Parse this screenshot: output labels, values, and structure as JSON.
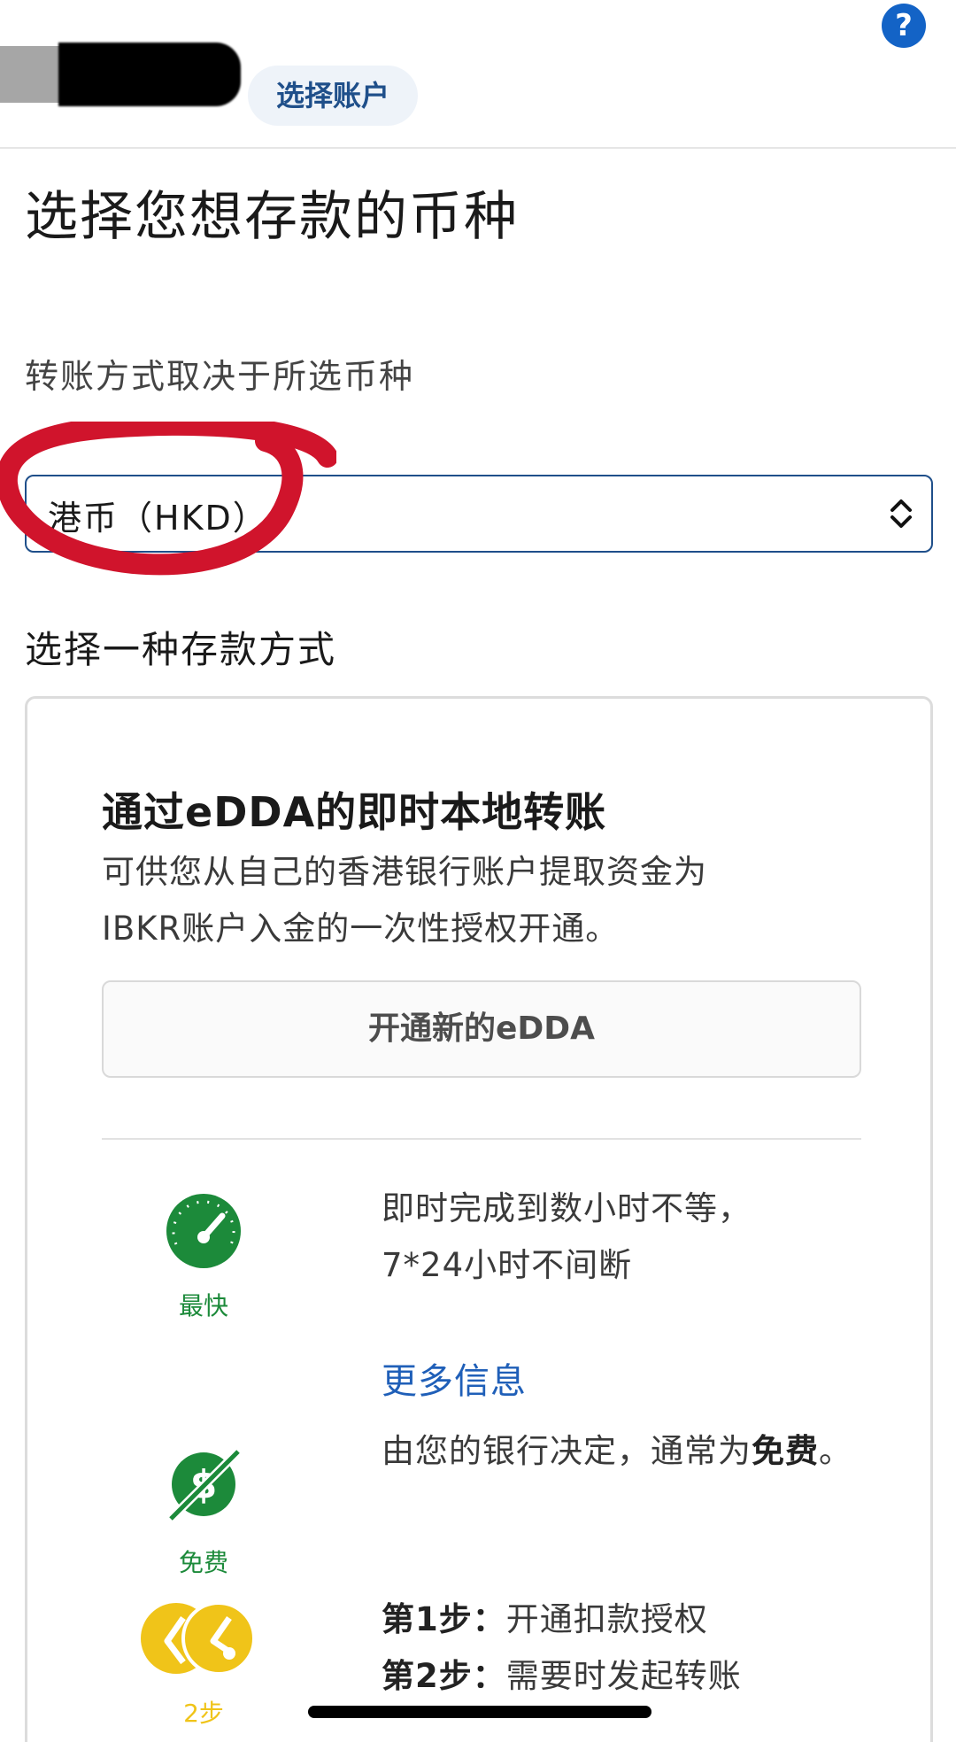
{
  "header": {
    "account_label": "选择账户",
    "help_label": "?"
  },
  "main": {
    "title": "选择您想存款的币种",
    "hint": "转账方式取决于所选币种",
    "currency_selected": "港币（HKD）",
    "methods_title": "选择一种存款方式"
  },
  "card": {
    "title": "通过eDDA的即时本地转账",
    "desc_line1": "可供您从自己的香港银行账户提取资金为",
    "desc_line2": "IBKR账户入金的一次性授权开通。",
    "button": "开通新的eDDA",
    "speed": {
      "icon": "speedometer-icon",
      "caption": "最快",
      "line1": "即时完成到数小时不等，",
      "line2": "7*24小时不间断"
    },
    "more_info": "更多信息",
    "fee": {
      "icon": "no-fee-dollar-icon",
      "caption": "免费",
      "text_prefix": "由您的银行决定，通常为",
      "text_bold": "免费",
      "text_suffix": "。"
    },
    "steps": {
      "icon": "two-steps-icon",
      "caption": "2步",
      "step1_label": "第1步：",
      "step1_text": "开通扣款授权",
      "step2_label": "第2步：",
      "step2_text": "需要时发起转账"
    }
  },
  "colors": {
    "brand_blue": "#1f4f8a",
    "help_blue": "#1363c6",
    "link_blue": "#1f5fb8",
    "green": "#1c8a3a",
    "gold": "#f0c419",
    "annotation_red": "#d0142c"
  }
}
